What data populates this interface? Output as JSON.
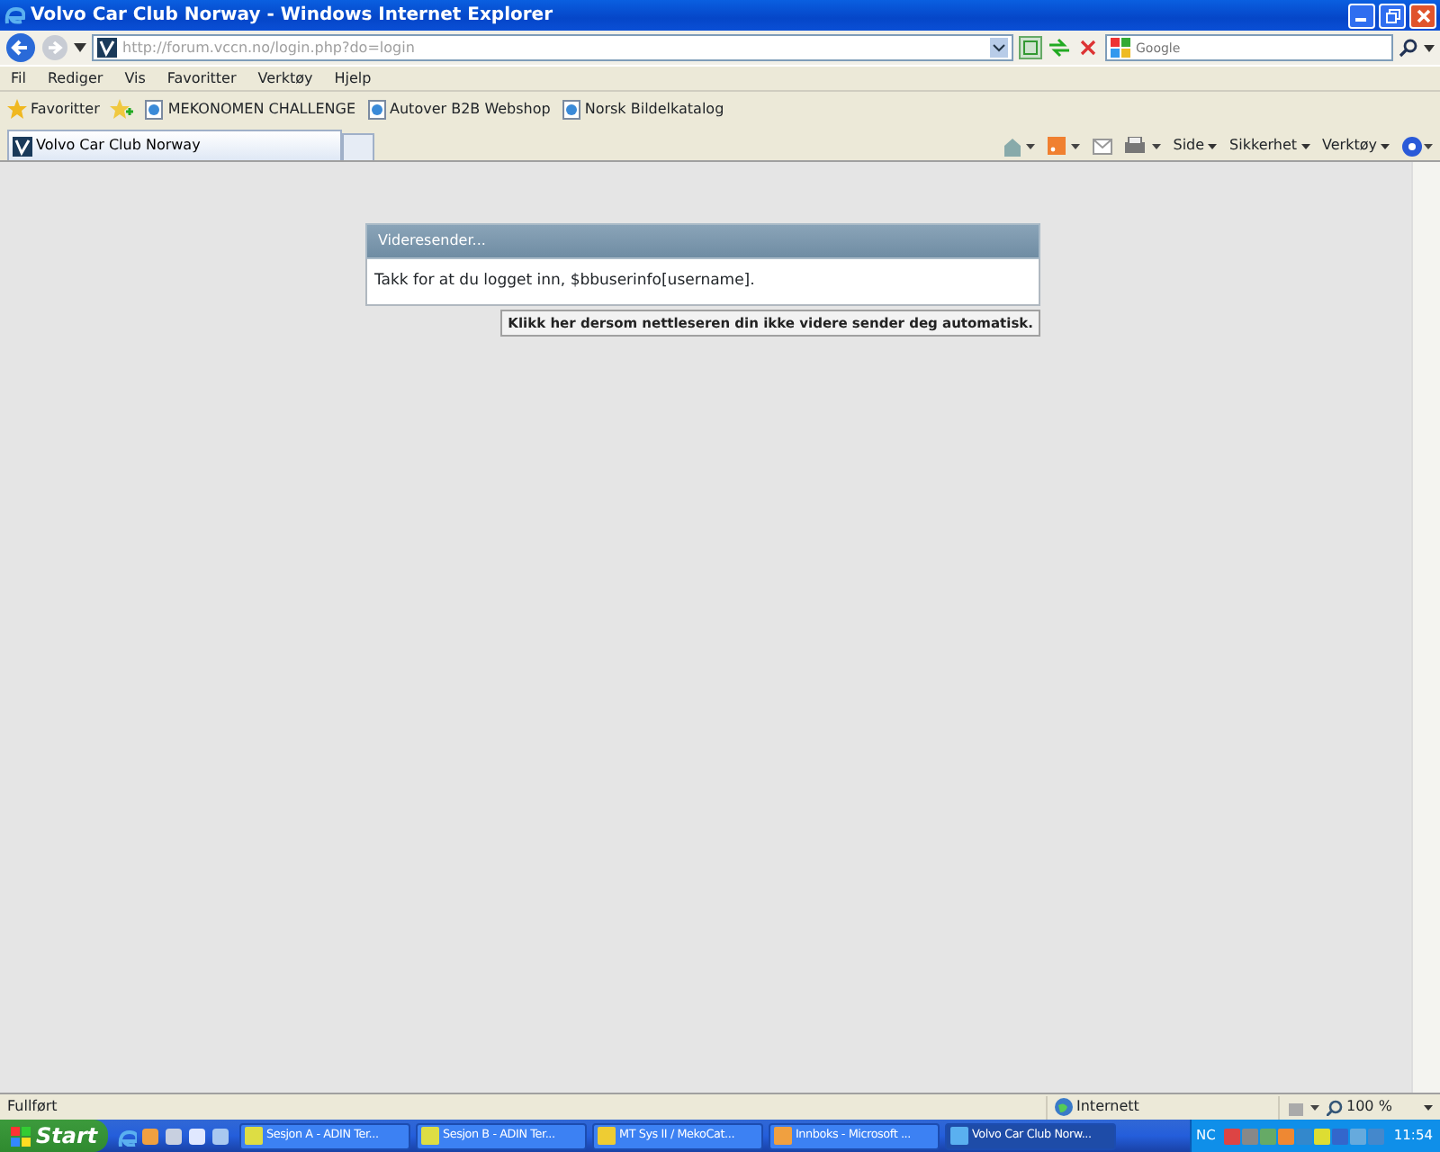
{
  "window": {
    "title": "Volvo Car Club Norway - Windows Internet Explorer"
  },
  "address_bar": {
    "url": "http://forum.vccn.no/login.php?do=login",
    "search_placeholder": "Google"
  },
  "menu": [
    "Fil",
    "Rediger",
    "Vis",
    "Favoritter",
    "Verktøy",
    "Hjelp"
  ],
  "favorites_bar": {
    "label": "Favoritter",
    "links": [
      "MEKONOMEN CHALLENGE",
      "Autover B2B Webshop",
      "Norsk Bildelkatalog"
    ]
  },
  "tabs": [
    {
      "label": "Volvo Car Club Norway",
      "selected": true
    }
  ],
  "command_bar": [
    "Side",
    "Sikkerhet",
    "Verktøy"
  ],
  "dialog": {
    "title": "Videresender...",
    "message": "Takk for at du logget inn, $bbuserinfo[username].",
    "link": "Klikk her dersom nettleseren din ikke videre sender deg automatisk."
  },
  "status_bar": {
    "text": "Fullført",
    "zone": "Internett",
    "zoom": "100 %"
  },
  "taskbar": {
    "start": "Start",
    "buttons": [
      {
        "label": "Sesjon A - ADIN Ter...",
        "selected": false
      },
      {
        "label": "Sesjon B - ADIN Ter...",
        "selected": false
      },
      {
        "label": "MT Sys II / MekoCat...",
        "selected": false
      },
      {
        "label": "Innboks - Microsoft ...",
        "selected": false
      },
      {
        "label": "Volvo Car Club Norw...",
        "selected": true
      }
    ],
    "language": "NC",
    "clock": "11:54"
  }
}
